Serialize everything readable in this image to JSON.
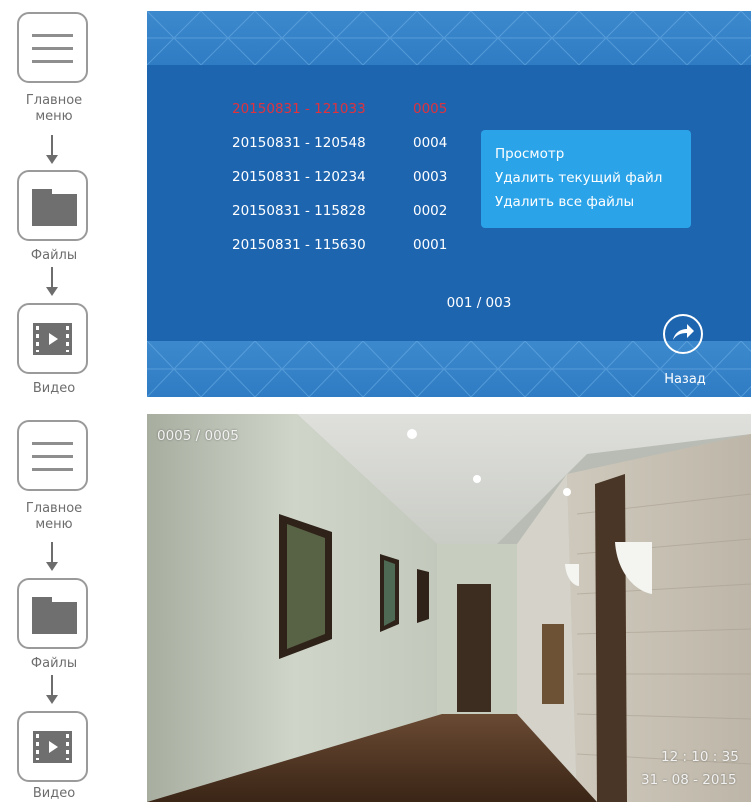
{
  "nav_top": {
    "main_menu_label_1": "Главное",
    "main_menu_label_2": "меню",
    "files_label": "Файлы",
    "video_label": "Видео"
  },
  "nav_bottom": {
    "main_menu_label_1": "Главное",
    "main_menu_label_2": "меню",
    "files_label": "Файлы",
    "video_label": "Видео"
  },
  "file_list": [
    {
      "name": "20150831 - 121033",
      "number": "0005",
      "selected": true
    },
    {
      "name": "20150831 - 120548",
      "number": "0004",
      "selected": false
    },
    {
      "name": "20150831 - 120234",
      "number": "0003",
      "selected": false
    },
    {
      "name": "20150831 - 115828",
      "number": "0002",
      "selected": false
    },
    {
      "name": "20150831 - 115630",
      "number": "0001",
      "selected": false
    }
  ],
  "context_menu": {
    "view": "Просмотр",
    "delete_current": "Удалить текущий файл",
    "delete_all": "Удалить все файлы"
  },
  "pager": "001 / 003",
  "back_label": "Назад",
  "playback": {
    "counter": "0005 / 0005",
    "time": "12 : 10 : 35",
    "date": "31 - 08 - 2015"
  },
  "colors": {
    "screen_bg": "#1e65b0",
    "band": "#3582c8",
    "selected_text": "#e0323c",
    "context_menu_bg": "#2aa3e8",
    "nav_gray": "#6f6f6f"
  },
  "icons": [
    "menu-icon",
    "folder-icon",
    "video-icon",
    "back-arrow-icon"
  ]
}
